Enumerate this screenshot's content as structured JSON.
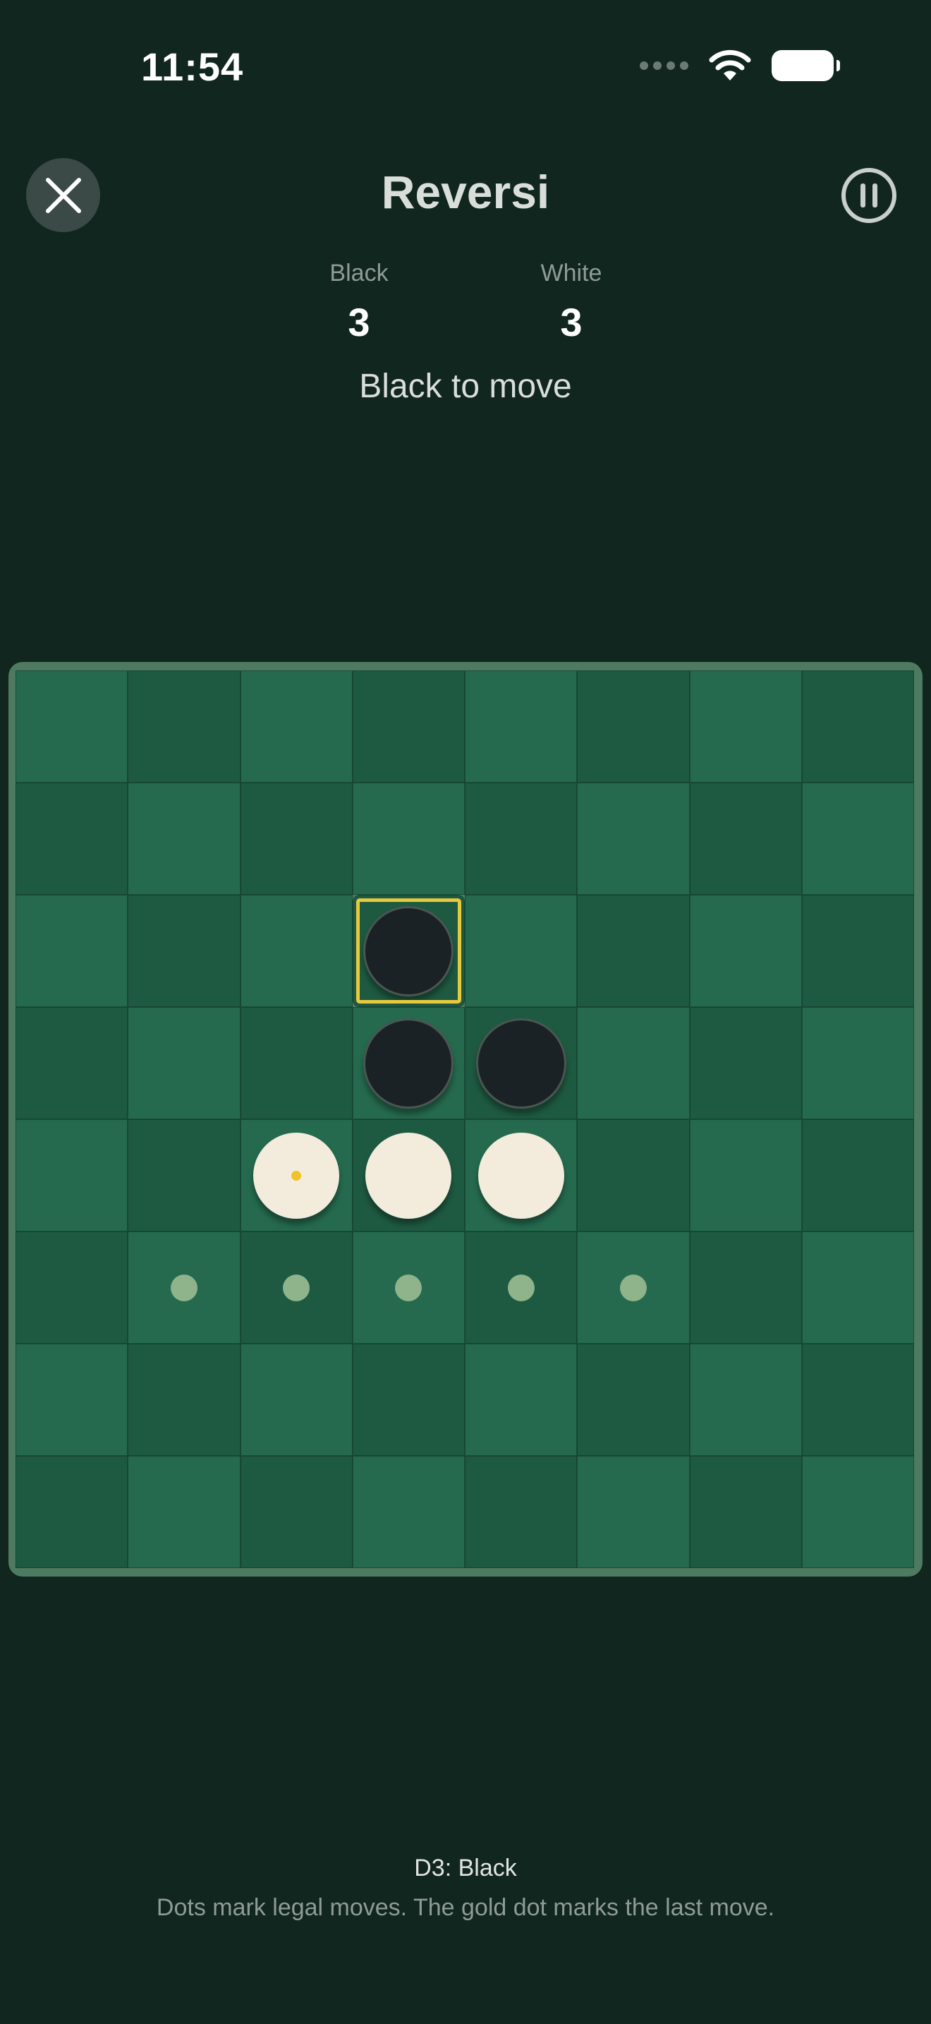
{
  "status_bar": {
    "time": "11:54"
  },
  "header": {
    "title": "Reversi",
    "close_icon": "close-icon",
    "pause_icon": "pause-icon"
  },
  "scores": {
    "black_label": "Black",
    "black_value": "3",
    "white_label": "White",
    "white_value": "3"
  },
  "turn_status": "Black to move",
  "board": {
    "size": 8,
    "rows": [
      [
        "",
        "",
        "",
        "",
        "",
        "",
        "",
        ""
      ],
      [
        "",
        "",
        "",
        "",
        "",
        "",
        "",
        ""
      ],
      [
        "",
        "",
        "",
        "B",
        "",
        "",
        "",
        ""
      ],
      [
        "",
        "",
        "",
        "B",
        "B",
        "",
        "",
        ""
      ],
      [
        "",
        "",
        "W",
        "W",
        "W",
        "",
        "",
        ""
      ],
      [
        "",
        "",
        "",
        "",
        "",
        "",
        "",
        ""
      ],
      [
        "",
        "",
        "",
        "",
        "",
        "",
        "",
        ""
      ],
      [
        "",
        "",
        "",
        "",
        "",
        "",
        "",
        ""
      ]
    ],
    "legal_moves": [
      [
        5,
        1
      ],
      [
        5,
        2
      ],
      [
        5,
        3
      ],
      [
        5,
        4
      ],
      [
        5,
        5
      ]
    ],
    "highlighted_cell": [
      2,
      3
    ],
    "gold_dot_cell": [
      4,
      2
    ],
    "colors": {
      "gold": "#e7c93e",
      "square_light": "#256a4e",
      "square_dark": "#1e5a42",
      "background": "#11261f"
    }
  },
  "footer": {
    "last_move": "D3: Black",
    "hint": "Dots mark legal moves. The gold dot marks the last move."
  }
}
